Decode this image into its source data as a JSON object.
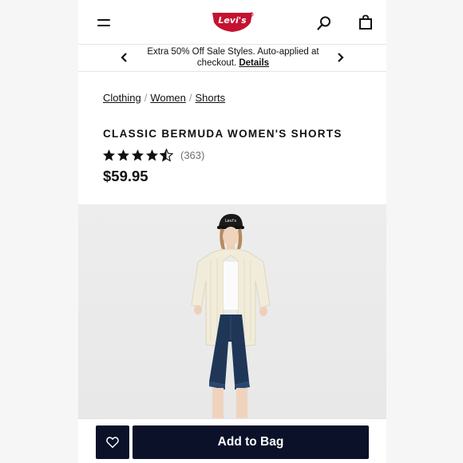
{
  "header": {
    "logo_text": "Levi's",
    "brand_color": "#c41230",
    "icons": [
      "menu-icon",
      "levis-logo",
      "search-icon",
      "shopping-bag-icon"
    ]
  },
  "promo": {
    "text": "Extra 50% Off Sale Styles. Auto-applied at checkout.",
    "link": "Details",
    "icons": [
      "chevron-left-icon",
      "chevron-right-icon"
    ]
  },
  "breadcrumb": [
    "Clothing",
    "Women",
    "Shorts"
  ],
  "product": {
    "title": "CLASSIC BERMUDA WOMEN'S SHORTS",
    "rating": 4.5,
    "rating_max": 5,
    "review_count": "(363)",
    "price": "$59.95"
  },
  "image": {
    "cap_logo_text": "Levi's"
  },
  "actions": {
    "add_to_bag": "Add to Bag",
    "wishlist_icon": "heart-icon",
    "button_color": "#0a1128"
  }
}
